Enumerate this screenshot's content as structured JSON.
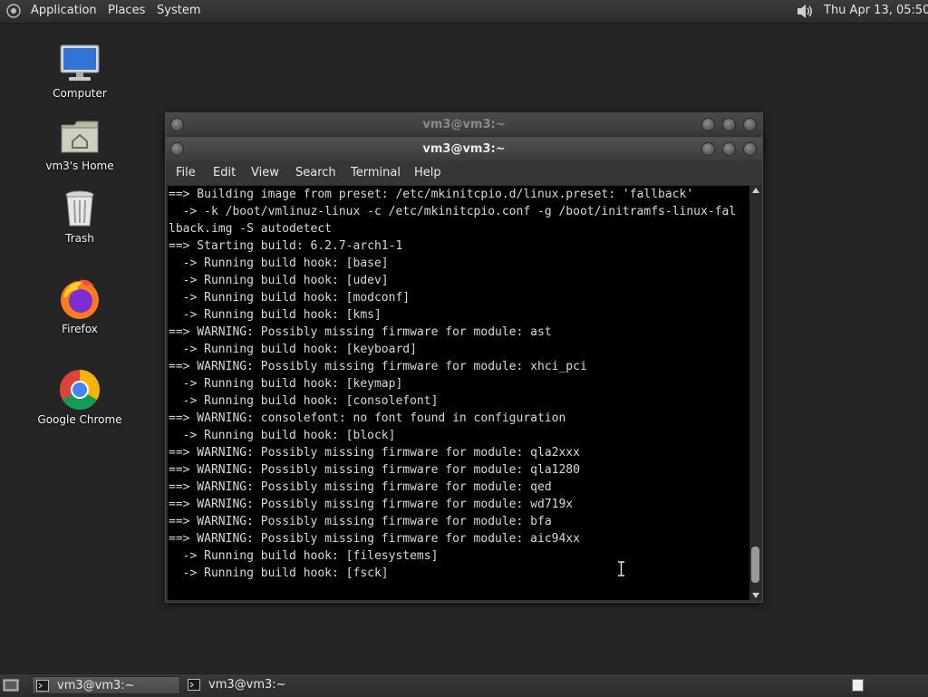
{
  "top_panel": {
    "menus": [
      "Applications",
      "Places",
      "System"
    ],
    "clock": "Thu Apr 13, 05:50"
  },
  "desktop": {
    "icons": [
      "Computer",
      "vm3's Home",
      "Trash",
      "Firefox",
      "Google Chrome"
    ]
  },
  "windows": {
    "back_title": "vm3@vm3:~",
    "front_title": "vm3@vm3:~",
    "menu": [
      "File",
      "Edit",
      "View",
      "Search",
      "Terminal",
      "Help"
    ]
  },
  "terminal": {
    "lines": [
      "==> Building image from preset: /etc/mkinitcpio.d/linux.preset: 'fallback'",
      "  -> -k /boot/vmlinuz-linux -c /etc/mkinitcpio.conf -g /boot/initramfs-linux-fal",
      "lback.img -S autodetect",
      "==> Starting build: 6.2.7-arch1-1",
      "  -> Running build hook: [base]",
      "  -> Running build hook: [udev]",
      "  -> Running build hook: [modconf]",
      "  -> Running build hook: [kms]",
      "==> WARNING: Possibly missing firmware for module: ast",
      "  -> Running build hook: [keyboard]",
      "==> WARNING: Possibly missing firmware for module: xhci_pci",
      "  -> Running build hook: [keymap]",
      "  -> Running build hook: [consolefont]",
      "==> WARNING: consolefont: no font found in configuration",
      "  -> Running build hook: [block]",
      "==> WARNING: Possibly missing firmware for module: qla2xxx",
      "==> WARNING: Possibly missing firmware for module: qla1280",
      "==> WARNING: Possibly missing firmware for module: qed",
      "==> WARNING: Possibly missing firmware for module: wd719x",
      "==> WARNING: Possibly missing firmware for module: bfa",
      "==> WARNING: Possibly missing firmware for module: aic94xx",
      "  -> Running build hook: [filesystems]",
      "  -> Running build hook: [fsck]"
    ]
  },
  "taskbar": {
    "tasks": [
      "vm3@vm3:~",
      "vm3@vm3:~"
    ]
  },
  "icons": {
    "app_menu": "gnome-foot-icon",
    "volume": "speaker-icon",
    "computer": "monitor-icon",
    "home": "home-folder-icon",
    "trash": "trash-icon",
    "firefox": "firefox-icon",
    "chrome": "chrome-icon",
    "terminal": "terminal-icon",
    "workspace": "workspace-switcher-icon"
  }
}
